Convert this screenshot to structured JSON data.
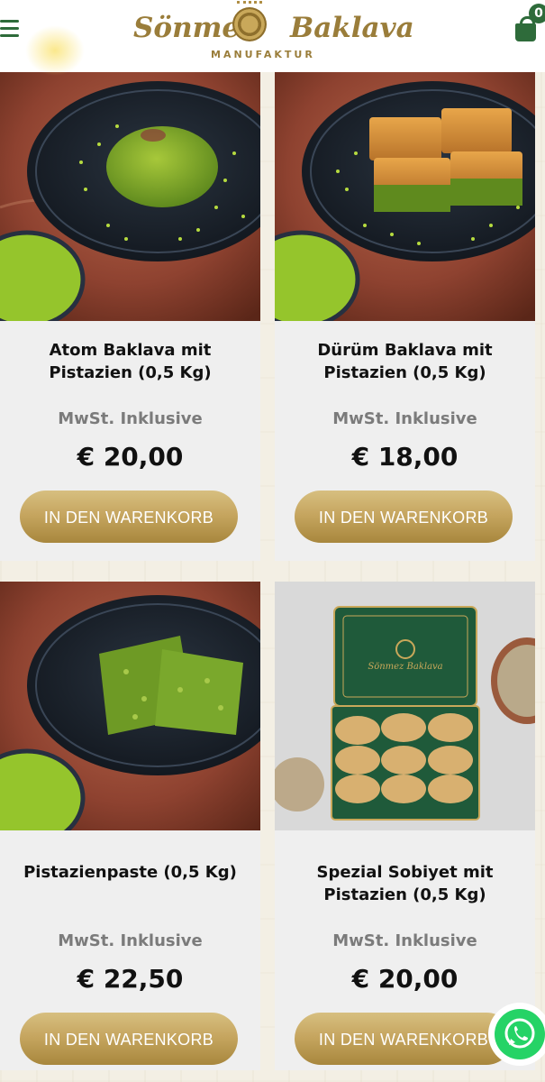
{
  "header": {
    "logo_left": "Sönmez",
    "logo_right": "Baklava",
    "logo_sub": "MANUFAKTUR",
    "cart_count": "0"
  },
  "products": [
    {
      "title": "Atom Baklava mit Pistazien (0,5 Kg)",
      "tax": "MwSt. Inklusive",
      "price": "€ 20,00",
      "button": "IN DEN WARENKORB"
    },
    {
      "title": "Dürüm Baklava mit Pistazien (0,5 Kg)",
      "tax": "MwSt. Inklusive",
      "price": "€ 18,00",
      "button": "IN DEN WARENKORB"
    },
    {
      "title": "Pistazienpaste (0,5 Kg)",
      "tax": "MwSt. Inklusive",
      "price": "€ 22,50",
      "button": "IN DEN WARENKORB"
    },
    {
      "title": "Spezial Sobiyet mit Pistazien (0,5 Kg)",
      "tax": "MwSt. Inklusive",
      "price": "€ 20,00",
      "button": "IN DEN WARENKORB"
    }
  ],
  "tin_label": "Sönmez Baklava",
  "icons": {
    "menu": "hamburger-menu-icon",
    "cart": "shopping-bag-icon",
    "whatsapp": "whatsapp-icon"
  },
  "colors": {
    "brand_green": "#2e6b3a",
    "brand_gold": "#9a7d3a",
    "button_gold": "#c6a660"
  }
}
